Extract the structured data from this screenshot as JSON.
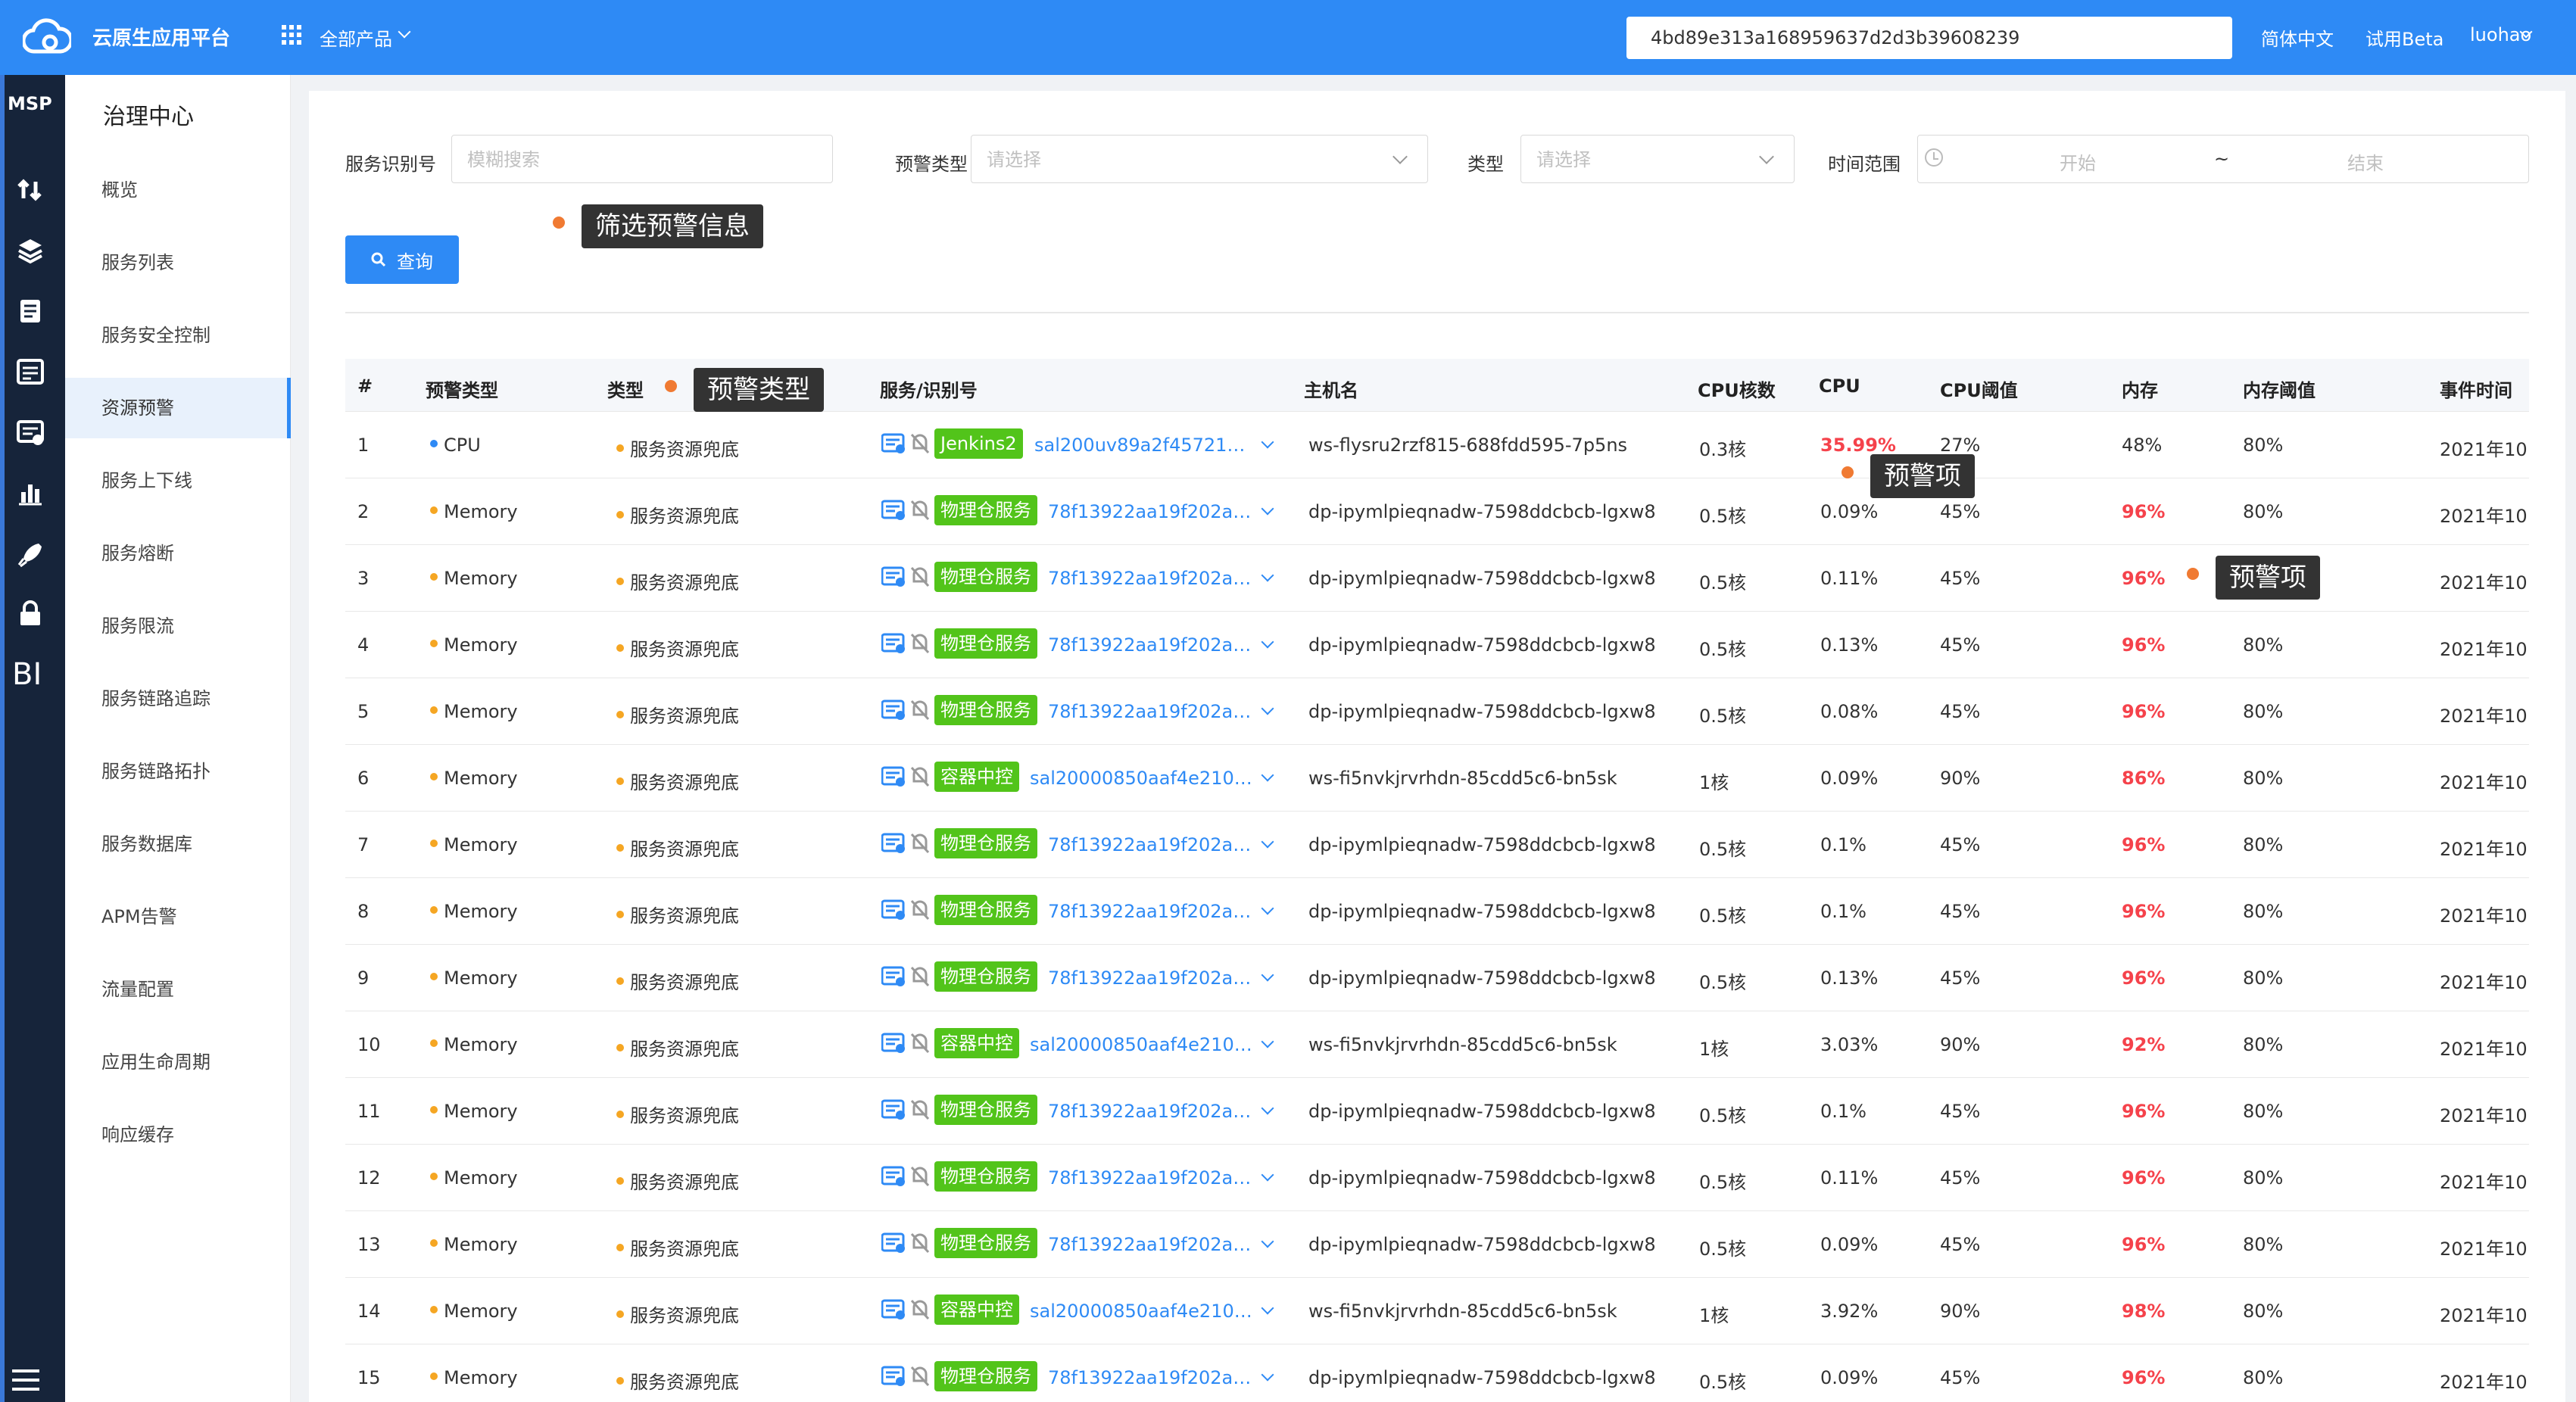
{
  "header": {
    "app_title": "云原生应用平台",
    "all_products": "全部产品",
    "search_value": "4bd89e313a168959637d2d3b39608239",
    "lang": "简体中文",
    "beta": "试用Beta",
    "user": "luohao",
    "icons": [
      "cloud-logo-icon",
      "grid-icon",
      "chevron-down-icon"
    ],
    "brand_color": "#2e8af5"
  },
  "leftbar": {
    "label": "MSP",
    "bi": "BI",
    "icons": [
      "transfer-icon",
      "layers-icon",
      "document-icon",
      "monitor-icon",
      "alert-card-icon",
      "bar-chart-icon",
      "rocket-icon",
      "lock-icon",
      "hamburger-icon"
    ]
  },
  "sidemenu": {
    "title": "治理中心",
    "items": [
      "概览",
      "服务列表",
      "服务安全控制",
      "资源预警",
      "服务上下线",
      "服务熔断",
      "服务限流",
      "服务链路追踪",
      "服务链路拓扑",
      "服务数据库",
      "APM告警",
      "流量配置",
      "应用生命周期",
      "响应缓存"
    ],
    "active": "资源预警"
  },
  "filters": {
    "service_id_label": "服务识别号",
    "service_id_placeholder": "模糊搜索",
    "alert_type_label": "预警类型",
    "alert_type_placeholder": "请选择",
    "type_label": "类型",
    "type_placeholder": "请选择",
    "time_range_label": "时间范围",
    "start_placeholder": "开始",
    "tilde": "~",
    "end_placeholder": "结束",
    "query_button": "查询"
  },
  "tooltips": {
    "filter": "筛选预警信息",
    "alert_type": "预警类型",
    "cpu_item": "预警项",
    "mem_item": "预警项"
  },
  "table": {
    "headers": [
      "#",
      "预警类型",
      "类型",
      "服务/识别号",
      "主机名",
      "CPU核数",
      "CPU",
      "CPU阈值",
      "内存",
      "内存阈值",
      "事件时间"
    ],
    "rows": [
      {
        "n": "1",
        "alert": "CPU",
        "type": "服务资源兜底",
        "tag": "Jenkins2",
        "sid": "sal200uv89a2f4572110…",
        "host": "ws-flysru2rzf815-688fdd595-7p5ns",
        "cores": "0.3核",
        "cpu": "35.99%",
        "cpu_th": "27%",
        "mem": "48%",
        "mem_th": "80%",
        "time": "2021年10"
      },
      {
        "n": "2",
        "alert": "Memory",
        "type": "服务资源兜底",
        "tag": "物理仓服务",
        "sid": "78f13922aa19f202ae…",
        "host": "dp-ipymlpieqnadw-7598ddcbcb-lgxw8",
        "cores": "0.5核",
        "cpu": "0.09%",
        "cpu_th": "45%",
        "mem": "96%",
        "mem_th": "80%",
        "time": "2021年10"
      },
      {
        "n": "3",
        "alert": "Memory",
        "type": "服务资源兜底",
        "tag": "物理仓服务",
        "sid": "78f13922aa19f202ae…",
        "host": "dp-ipymlpieqnadw-7598ddcbcb-lgxw8",
        "cores": "0.5核",
        "cpu": "0.11%",
        "cpu_th": "45%",
        "mem": "96%",
        "mem_th": "80%",
        "time": "2021年10"
      },
      {
        "n": "4",
        "alert": "Memory",
        "type": "服务资源兜底",
        "tag": "物理仓服务",
        "sid": "78f13922aa19f202ae…",
        "host": "dp-ipymlpieqnadw-7598ddcbcb-lgxw8",
        "cores": "0.5核",
        "cpu": "0.13%",
        "cpu_th": "45%",
        "mem": "96%",
        "mem_th": "80%",
        "time": "2021年10"
      },
      {
        "n": "5",
        "alert": "Memory",
        "type": "服务资源兜底",
        "tag": "物理仓服务",
        "sid": "78f13922aa19f202ae…",
        "host": "dp-ipymlpieqnadw-7598ddcbcb-lgxw8",
        "cores": "0.5核",
        "cpu": "0.08%",
        "cpu_th": "45%",
        "mem": "96%",
        "mem_th": "80%",
        "time": "2021年10"
      },
      {
        "n": "6",
        "alert": "Memory",
        "type": "服务资源兜底",
        "tag": "容器中控",
        "sid": "sal20000850aaf4e2105…",
        "host": "ws-fi5nvkjrvrhdn-85cdd5c6-bn5sk",
        "cores": "1核",
        "cpu": "0.09%",
        "cpu_th": "90%",
        "mem": "86%",
        "mem_th": "80%",
        "time": "2021年10"
      },
      {
        "n": "7",
        "alert": "Memory",
        "type": "服务资源兜底",
        "tag": "物理仓服务",
        "sid": "78f13922aa19f202ae…",
        "host": "dp-ipymlpieqnadw-7598ddcbcb-lgxw8",
        "cores": "0.5核",
        "cpu": "0.1%",
        "cpu_th": "45%",
        "mem": "96%",
        "mem_th": "80%",
        "time": "2021年10"
      },
      {
        "n": "8",
        "alert": "Memory",
        "type": "服务资源兜底",
        "tag": "物理仓服务",
        "sid": "78f13922aa19f202ae…",
        "host": "dp-ipymlpieqnadw-7598ddcbcb-lgxw8",
        "cores": "0.5核",
        "cpu": "0.1%",
        "cpu_th": "45%",
        "mem": "96%",
        "mem_th": "80%",
        "time": "2021年10"
      },
      {
        "n": "9",
        "alert": "Memory",
        "type": "服务资源兜底",
        "tag": "物理仓服务",
        "sid": "78f13922aa19f202ae…",
        "host": "dp-ipymlpieqnadw-7598ddcbcb-lgxw8",
        "cores": "0.5核",
        "cpu": "0.13%",
        "cpu_th": "45%",
        "mem": "96%",
        "mem_th": "80%",
        "time": "2021年10"
      },
      {
        "n": "10",
        "alert": "Memory",
        "type": "服务资源兜底",
        "tag": "容器中控",
        "sid": "sal20000850aaf4e2105…",
        "host": "ws-fi5nvkjrvrhdn-85cdd5c6-bn5sk",
        "cores": "1核",
        "cpu": "3.03%",
        "cpu_th": "90%",
        "mem": "92%",
        "mem_th": "80%",
        "time": "2021年10"
      },
      {
        "n": "11",
        "alert": "Memory",
        "type": "服务资源兜底",
        "tag": "物理仓服务",
        "sid": "78f13922aa19f202ae…",
        "host": "dp-ipymlpieqnadw-7598ddcbcb-lgxw8",
        "cores": "0.5核",
        "cpu": "0.1%",
        "cpu_th": "45%",
        "mem": "96%",
        "mem_th": "80%",
        "time": "2021年10"
      },
      {
        "n": "12",
        "alert": "Memory",
        "type": "服务资源兜底",
        "tag": "物理仓服务",
        "sid": "78f13922aa19f202ae…",
        "host": "dp-ipymlpieqnadw-7598ddcbcb-lgxw8",
        "cores": "0.5核",
        "cpu": "0.11%",
        "cpu_th": "45%",
        "mem": "96%",
        "mem_th": "80%",
        "time": "2021年10"
      },
      {
        "n": "13",
        "alert": "Memory",
        "type": "服务资源兜底",
        "tag": "物理仓服务",
        "sid": "78f13922aa19f202ae…",
        "host": "dp-ipymlpieqnadw-7598ddcbcb-lgxw8",
        "cores": "0.5核",
        "cpu": "0.09%",
        "cpu_th": "45%",
        "mem": "96%",
        "mem_th": "80%",
        "time": "2021年10"
      },
      {
        "n": "14",
        "alert": "Memory",
        "type": "服务资源兜底",
        "tag": "容器中控",
        "sid": "sal20000850aaf4e2105…",
        "host": "ws-fi5nvkjrvrhdn-85cdd5c6-bn5sk",
        "cores": "1核",
        "cpu": "3.92%",
        "cpu_th": "90%",
        "mem": "98%",
        "mem_th": "80%",
        "time": "2021年10"
      },
      {
        "n": "15",
        "alert": "Memory",
        "type": "服务资源兜底",
        "tag": "物理仓服务",
        "sid": "78f13922aa19f202ae…",
        "host": "dp-ipymlpieqnadw-7598ddcbcb-lgxw8",
        "cores": "0.5核",
        "cpu": "0.09%",
        "cpu_th": "45%",
        "mem": "96%",
        "mem_th": "80%",
        "time": "2021年10"
      }
    ]
  }
}
